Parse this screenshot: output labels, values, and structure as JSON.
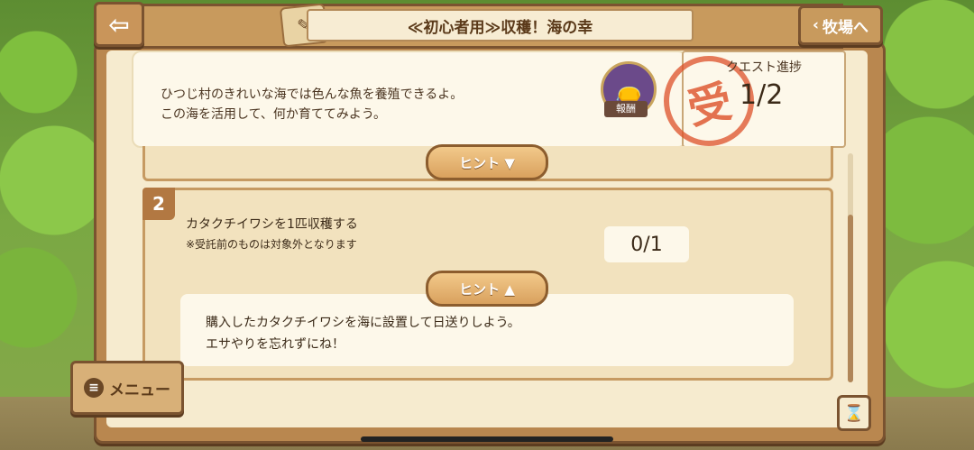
{
  "header": {
    "back_label": "⇦",
    "title": "≪初心者用≫収穫！海の幸",
    "ranch_button": "牧場へ"
  },
  "quest": {
    "description_line1": "ひつじ村のきれいな海では色んな魚を養殖できるよ。",
    "description_line2": "この海を活用して、何か育ててみよう。",
    "reward_label": "報酬",
    "progress_label": "クエスト進捗",
    "progress_value": "1/2",
    "stamp_char": "受"
  },
  "tasks": [
    {
      "hint_label": "ヒント ▼"
    },
    {
      "number": "2",
      "title": "カタクチイワシを1匹収穫する",
      "note": "※受託前のものは対象外となります",
      "count": "0/1",
      "hint_label": "ヒント ▲",
      "hint_line1": "購入したカタクチイワシを海に設置して日送りしよう。",
      "hint_line2": "エサやりを忘れずにね！"
    }
  ],
  "footer": {
    "menu_label": "メニュー",
    "menu_icon": "≡",
    "hourglass_icon": "⌛"
  }
}
